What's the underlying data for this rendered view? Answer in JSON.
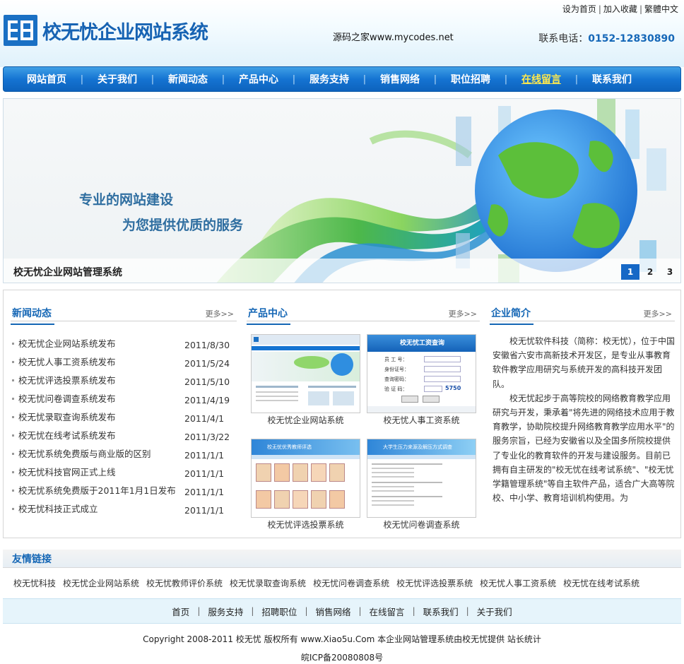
{
  "header": {
    "logo_text": "校无忧企业网站系统",
    "site_name": "源码之家www.mycodes.net",
    "top_links": [
      "设为首页",
      "加入收藏",
      "繁體中文"
    ],
    "phone_label": "联系电话：",
    "phone_number": "0152-12830890"
  },
  "nav": {
    "items": [
      "网站首页",
      "关于我们",
      "新闻动态",
      "产品中心",
      "服务支持",
      "销售网络",
      "职位招聘",
      "在线留言",
      "联系我们"
    ],
    "active_index": 7
  },
  "banner": {
    "line1": "专业的网站建设",
    "line2": "为您提供优质的服务",
    "caption": "校无忧企业网站管理系统",
    "pages": [
      "1",
      "2",
      "3"
    ],
    "active_page": 0
  },
  "news": {
    "title": "新闻动态",
    "more": "更多>>",
    "items": [
      {
        "title": "校无忧企业网站系统发布",
        "date": "2011/8/30"
      },
      {
        "title": "校无忧人事工资系统发布",
        "date": "2011/5/24"
      },
      {
        "title": "校无忧评选投票系统发布",
        "date": "2011/5/10"
      },
      {
        "title": "校无忧问卷调查系统发布",
        "date": "2011/4/19"
      },
      {
        "title": "校无忧录取查询系统发布",
        "date": "2011/4/1"
      },
      {
        "title": "校无忧在线考试系统发布",
        "date": "2011/3/22"
      },
      {
        "title": "校无忧系统免费版与商业版的区别",
        "date": "2011/1/1"
      },
      {
        "title": "校无忧科技官网正式上线",
        "date": "2011/1/1"
      },
      {
        "title": "校无忧系统免费版于2011年1月1日发布",
        "date": "2011/1/1"
      },
      {
        "title": "校无忧科技正式成立",
        "date": "2011/1/1"
      }
    ]
  },
  "products": {
    "title": "产品中心",
    "more": "更多>>",
    "items": [
      {
        "caption": "校无忧企业网站系统"
      },
      {
        "caption": "校无忧人事工资系统",
        "thumb_title": "校无忧工资查询",
        "fields": [
          "员 工 号：",
          "身份证号：",
          "查询密码：",
          "验 证 码："
        ],
        "code": "5750"
      },
      {
        "caption": "校无忧评选投票系统",
        "thumb_title": "校无忧优秀教师评选"
      },
      {
        "caption": "校无忧问卷调查系统",
        "thumb_title": "大学生压力来源及解压方式调查"
      }
    ]
  },
  "intro": {
    "title": "企业简介",
    "more": "更多>>",
    "text": "校无忧软件科技（简称：校无忧），位于中国安徽省六安市高新技术开发区，是专业从事教育软件教学应用研究与系统开发的高科技开发团队。",
    "text2": "校无忧起步于高等院校的网络教育教学应用研究与开发，秉承着\"将先进的网络技术应用于教育教学，协助院校提升网络教育教学应用水平\"的服务宗旨，已经为安徽省以及全国多所院校提供了专业化的教育软件的开发与建设服务。目前已拥有自主研发的\"校无忧在线考试系统\"、\"校无忧学籍管理系统\"等自主软件产品，适合广大高等院校、中小学、教育培训机构使用。为"
  },
  "friend_links": {
    "title": "友情链接",
    "items": [
      "校无忧科技",
      "校无忧企业网站系统",
      "校无忧教师评价系统",
      "校无忧录取查询系统",
      "校无忧问卷调查系统",
      "校无忧评选投票系统",
      "校无忧人事工资系统",
      "校无忧在线考试系统"
    ]
  },
  "footer": {
    "nav": [
      "首页",
      "服务支持",
      "招聘职位",
      "销售网络",
      "在线留言",
      "联系我们",
      "关于我们"
    ],
    "copyright": "Copyright 2008-2011 校无忧 版权所有 www.Xiao5u.Com 本企业网站管理系统由校无忧提供 站长统计",
    "icp": "皖ICP备20080808号"
  },
  "colors": {
    "brand_blue": "#1668c6",
    "nav_active": "#ffe94d",
    "title_blue": "#1466b5"
  }
}
